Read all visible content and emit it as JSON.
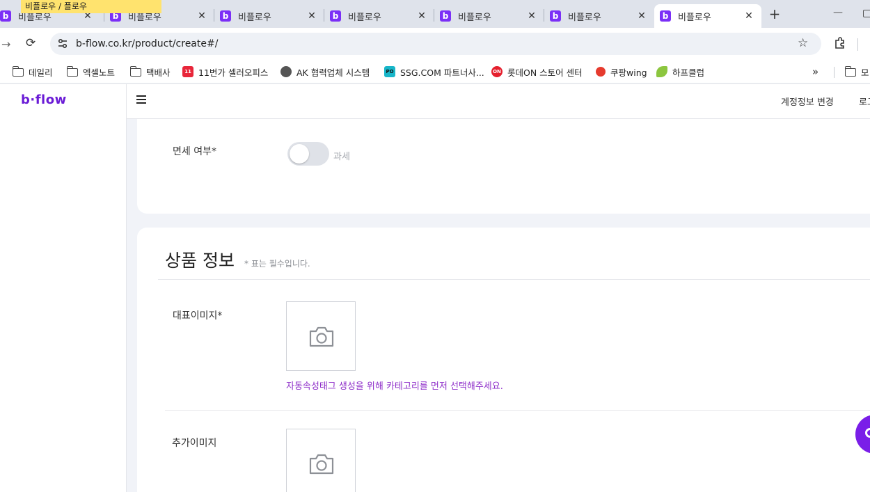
{
  "browser": {
    "tooltip": "비플로우 / 플로우",
    "tabs": [
      {
        "title": "비플로우",
        "active": false
      },
      {
        "title": "비플로우",
        "active": false
      },
      {
        "title": "비플로우",
        "active": false
      },
      {
        "title": "비플로우",
        "active": false
      },
      {
        "title": "비플로우",
        "active": false
      },
      {
        "title": "비플로우",
        "active": false
      },
      {
        "title": "비플로우",
        "active": true
      }
    ],
    "favicon_letter": "b",
    "url": "b-flow.co.kr/product/create#/",
    "bookmarks": [
      {
        "label": "데일리",
        "icon": "folder-icon"
      },
      {
        "label": "엑셀노트",
        "icon": "folder-icon"
      },
      {
        "label": "택배사",
        "icon": "folder-icon"
      },
      {
        "label": "11번가 셀러오피스",
        "icon": "11st-icon",
        "badge": "11",
        "color": "#e8263a"
      },
      {
        "label": "AK  협력업체 시스템",
        "icon": "globe-icon",
        "color": "#444444"
      },
      {
        "label": "SSG.COM 파트너사...",
        "icon": "ssg-po-icon",
        "badge": "PO",
        "color": "#18b6c9"
      },
      {
        "label": "롯데ON 스토어 센터",
        "icon": "lotteon-icon",
        "badge": "ON",
        "color": "#e5202e"
      },
      {
        "label": "쿠팡wing",
        "icon": "coupang-icon",
        "color": "#e63b2e"
      },
      {
        "label": "하프클럽",
        "icon": "leaf-icon",
        "color": "#8cc63f"
      },
      {
        "label": "모",
        "icon": "folder-icon"
      }
    ]
  },
  "app": {
    "logo": "b·flow",
    "header": {
      "account_link": "계정정보 변경",
      "logout_link": "로그아웃"
    },
    "tax_section": {
      "label": "면세 여부*",
      "toggle_on": false,
      "toggle_text": "과세"
    },
    "product_section": {
      "title": "상품 정보",
      "required_note": "* 표는 필수입니다.",
      "main_image_label": "대표이미지*",
      "hint": "자동속성태그 생성을 위해 카테고리를 먼저 선택해주세요.",
      "extra_image_label": "추가이미지"
    },
    "accent_color": "#7a1ee8"
  }
}
